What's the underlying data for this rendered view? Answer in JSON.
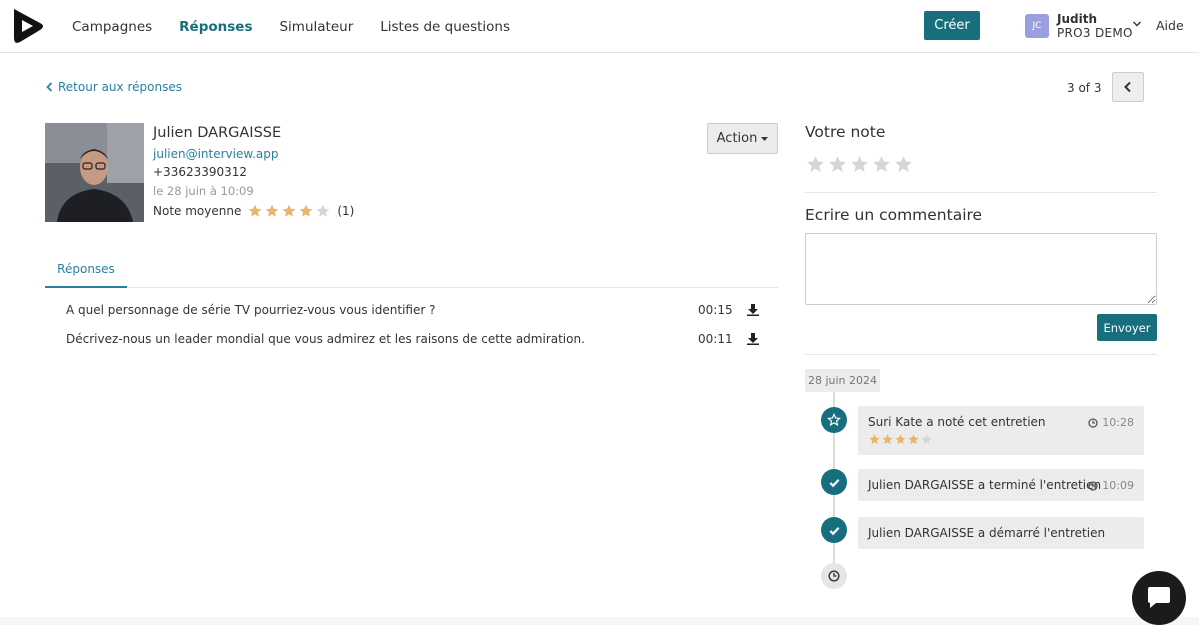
{
  "nav": {
    "items": [
      "Campagnes",
      "Réponses",
      "Simulateur",
      "Listes de questions"
    ],
    "active_index": 1,
    "create_label": "Créer",
    "help_label": "Aide"
  },
  "user": {
    "initials": "JC",
    "name": "Judith",
    "org": "PRO3 DEMO"
  },
  "back_label": "Retour aux réponses",
  "pager": {
    "text": "3 of 3"
  },
  "candidate": {
    "name": "Julien DARGAISSE",
    "email": "julien@interview.app",
    "phone": "+33623390312",
    "date": "le 28 juin à 10:09",
    "avg_label": "Note moyenne",
    "avg_rating": 4,
    "avg_max": 5,
    "rating_count": "(1)"
  },
  "action_label": "Action",
  "tabs": [
    "Réponses"
  ],
  "questions": [
    {
      "text": "A quel personnage de série TV pourriez-vous vous identifier ?",
      "duration": "00:15"
    },
    {
      "text": "Décrivez-nous un leader mondial que vous admirez et les raisons de cette admiration.",
      "duration": "00:11"
    }
  ],
  "rating_panel": {
    "title": "Votre note",
    "rating": 0,
    "max": 5
  },
  "comment_panel": {
    "title": "Ecrire un commentaire",
    "value": "",
    "send_label": "Envoyer"
  },
  "timeline": {
    "date": "28 juin 2024",
    "events": [
      {
        "text": "Suri Kate a noté cet entretien",
        "time": "10:28",
        "icon": "star-icon",
        "rating": 4
      },
      {
        "text": "Julien DARGAISSE a terminé l'entretien",
        "time": "10:09",
        "icon": "check-icon"
      },
      {
        "text": "Julien DARGAISSE a démarré l'entretien",
        "time": "",
        "icon": "check-icon"
      }
    ]
  },
  "colors": {
    "brand": "#176f7e",
    "link": "#2a7fa0",
    "star_filled": "#e9b56a",
    "star_empty": "#d6d6d6"
  }
}
